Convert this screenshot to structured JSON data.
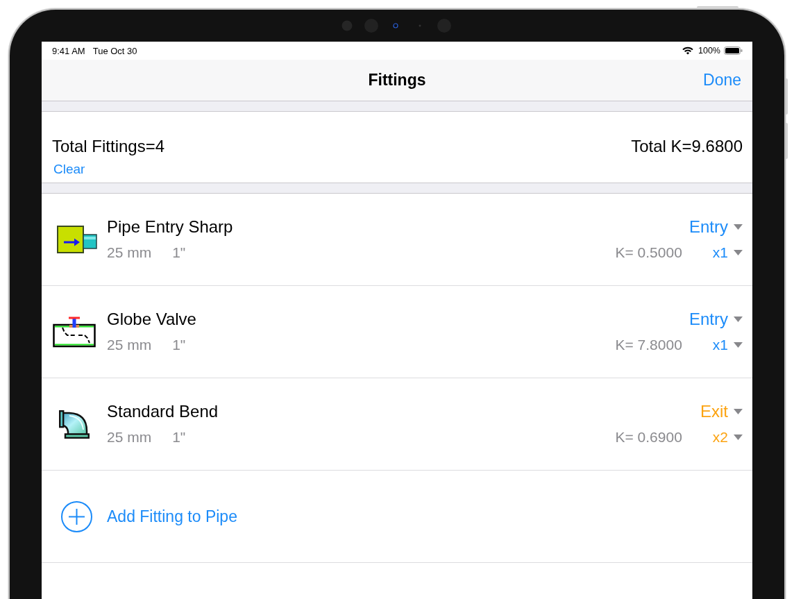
{
  "status_bar": {
    "time": "9:41 AM",
    "date": "Tue Oct 30",
    "battery": "100%"
  },
  "nav_bar": {
    "title": "Fittings",
    "done": "Done"
  },
  "summary": {
    "total_fittings": "Total Fittings=4",
    "total_k": "Total K=9.6800",
    "clear": "Clear"
  },
  "fittings": [
    {
      "kind": "entry",
      "name": "Pipe Entry Sharp",
      "size_mm": "25 mm",
      "size_in": "1\"",
      "position": "Entry",
      "k": "K= 0.5000",
      "quantity": "x1",
      "color": "#1b8bf9"
    },
    {
      "kind": "valve",
      "name": "Globe Valve",
      "size_mm": "25 mm",
      "size_in": "1\"",
      "position": "Entry",
      "k": "K= 7.8000",
      "quantity": "x1",
      "color": "#1b8bf9"
    },
    {
      "kind": "bend",
      "name": "Standard Bend",
      "size_mm": "25 mm",
      "size_in": "1\"",
      "position": "Exit",
      "k": "K= 0.6900",
      "quantity": "x2",
      "color": "#fca311"
    }
  ],
  "add_fitting": "Add Fitting to Pipe"
}
